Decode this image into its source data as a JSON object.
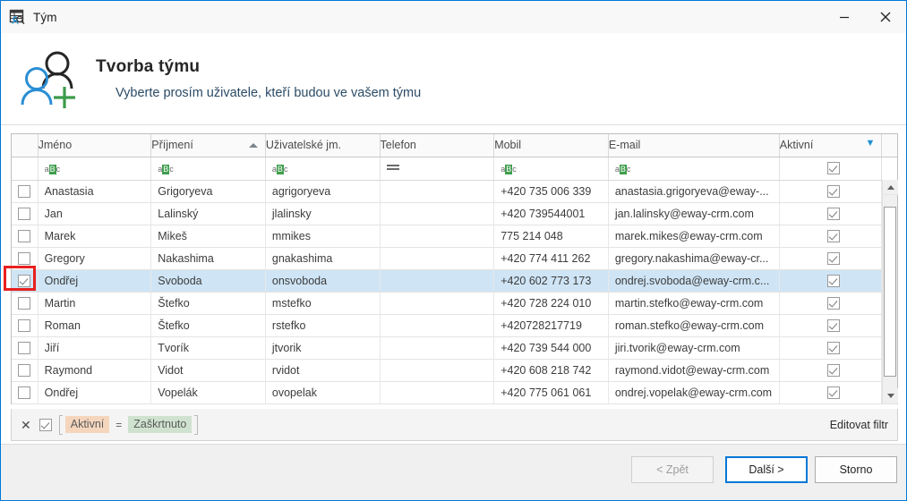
{
  "window": {
    "title": "Tým",
    "icon": "team-search-icon",
    "minimize_label": "–",
    "close_label": "✕",
    "accent": "#0078d7"
  },
  "banner": {
    "icon": "add-person-icon",
    "title": "Tvorba týmu",
    "subtitle": "Vyberte prosím uživatele, kteří budou ve vašem týmu"
  },
  "grid": {
    "columns": [
      {
        "key": "check",
        "label": ""
      },
      {
        "key": "jmeno",
        "label": "Jméno"
      },
      {
        "key": "prijmeni",
        "label": "Příjmení",
        "sorted": "asc"
      },
      {
        "key": "uzivatel",
        "label": "Uživatelské jm."
      },
      {
        "key": "telefon",
        "label": "Telefon"
      },
      {
        "key": "mobil",
        "label": "Mobil"
      },
      {
        "key": "email",
        "label": "E-mail"
      },
      {
        "key": "aktivni",
        "label": "Aktivní",
        "filtered": true
      }
    ],
    "filter_row": {
      "jmeno": "aBc",
      "prijmeni": "aBc",
      "uzivatel": "aBc",
      "telefon": "=",
      "mobil": "aBc",
      "email": "aBc",
      "aktivni": "checked"
    },
    "rows": [
      {
        "checked": false,
        "selected": false,
        "highlight": false,
        "jmeno": "Anastasia",
        "prijmeni": "Grigoryeva",
        "uzivatel": "agrigoryeva",
        "telefon": "",
        "mobil": "+420 735 006 339",
        "email": "anastasia.grigoryeva@eway-...",
        "aktivni": true
      },
      {
        "checked": false,
        "selected": false,
        "highlight": false,
        "jmeno": "Jan",
        "prijmeni": "Lalinský",
        "uzivatel": "jlalinsky",
        "telefon": "",
        "mobil": "+420 739544001",
        "email": "jan.lalinsky@eway-crm.com",
        "aktivni": true
      },
      {
        "checked": false,
        "selected": false,
        "highlight": false,
        "jmeno": "Marek",
        "prijmeni": "Mikeš",
        "uzivatel": "mmikes",
        "telefon": "",
        "mobil": "775 214 048",
        "email": "marek.mikes@eway-crm.com",
        "aktivni": true
      },
      {
        "checked": false,
        "selected": false,
        "highlight": false,
        "jmeno": "Gregory",
        "prijmeni": "Nakashima",
        "uzivatel": "gnakashima",
        "telefon": "",
        "mobil": "+420 774 411 262",
        "email": "gregory.nakashima@eway-cr...",
        "aktivni": true
      },
      {
        "checked": true,
        "selected": true,
        "highlight": true,
        "jmeno": "Ondřej",
        "prijmeni": "Svoboda",
        "uzivatel": "onsvoboda",
        "telefon": "",
        "mobil": "+420 602 773 173",
        "email": "ondrej.svoboda@eway-crm.c...",
        "aktivni": true
      },
      {
        "checked": false,
        "selected": false,
        "highlight": false,
        "jmeno": "Martin",
        "prijmeni": "Štefko",
        "uzivatel": "mstefko",
        "telefon": "",
        "mobil": "+420 728 224 010",
        "email": "martin.stefko@eway-crm.com",
        "aktivni": true
      },
      {
        "checked": false,
        "selected": false,
        "highlight": false,
        "jmeno": "Roman",
        "prijmeni": "Štefko",
        "uzivatel": "rstefko",
        "telefon": "",
        "mobil": "+420728217719",
        "email": "roman.stefko@eway-crm.com",
        "aktivni": true
      },
      {
        "checked": false,
        "selected": false,
        "highlight": false,
        "jmeno": "Jiří",
        "prijmeni": "Tvorík",
        "uzivatel": "jtvorik",
        "telefon": "",
        "mobil": "+420 739 544 000",
        "email": "jiri.tvorik@eway-crm.com",
        "aktivni": true
      },
      {
        "checked": false,
        "selected": false,
        "highlight": false,
        "jmeno": "Raymond",
        "prijmeni": "Vidot",
        "uzivatel": "rvidot",
        "telefon": "",
        "mobil": "+420 608 218 742",
        "email": "raymond.vidot@eway-crm.com",
        "aktivni": true
      },
      {
        "checked": false,
        "selected": false,
        "highlight": false,
        "jmeno": "Ondřej",
        "prijmeni": "Vopelák",
        "uzivatel": "ovopelak",
        "telefon": "",
        "mobil": "+420 775 061 061",
        "email": "ondrej.vopelak@eway-crm.com",
        "aktivni": true
      }
    ]
  },
  "filter_bar": {
    "close_label": "✕",
    "enabled": true,
    "field": "Aktivní",
    "operator": "=",
    "value": "Zaškrtnuto",
    "edit_label": "Editovat filtr"
  },
  "footer": {
    "back_label": "< Zpět",
    "next_label": "Další >",
    "cancel_label": "Storno"
  }
}
